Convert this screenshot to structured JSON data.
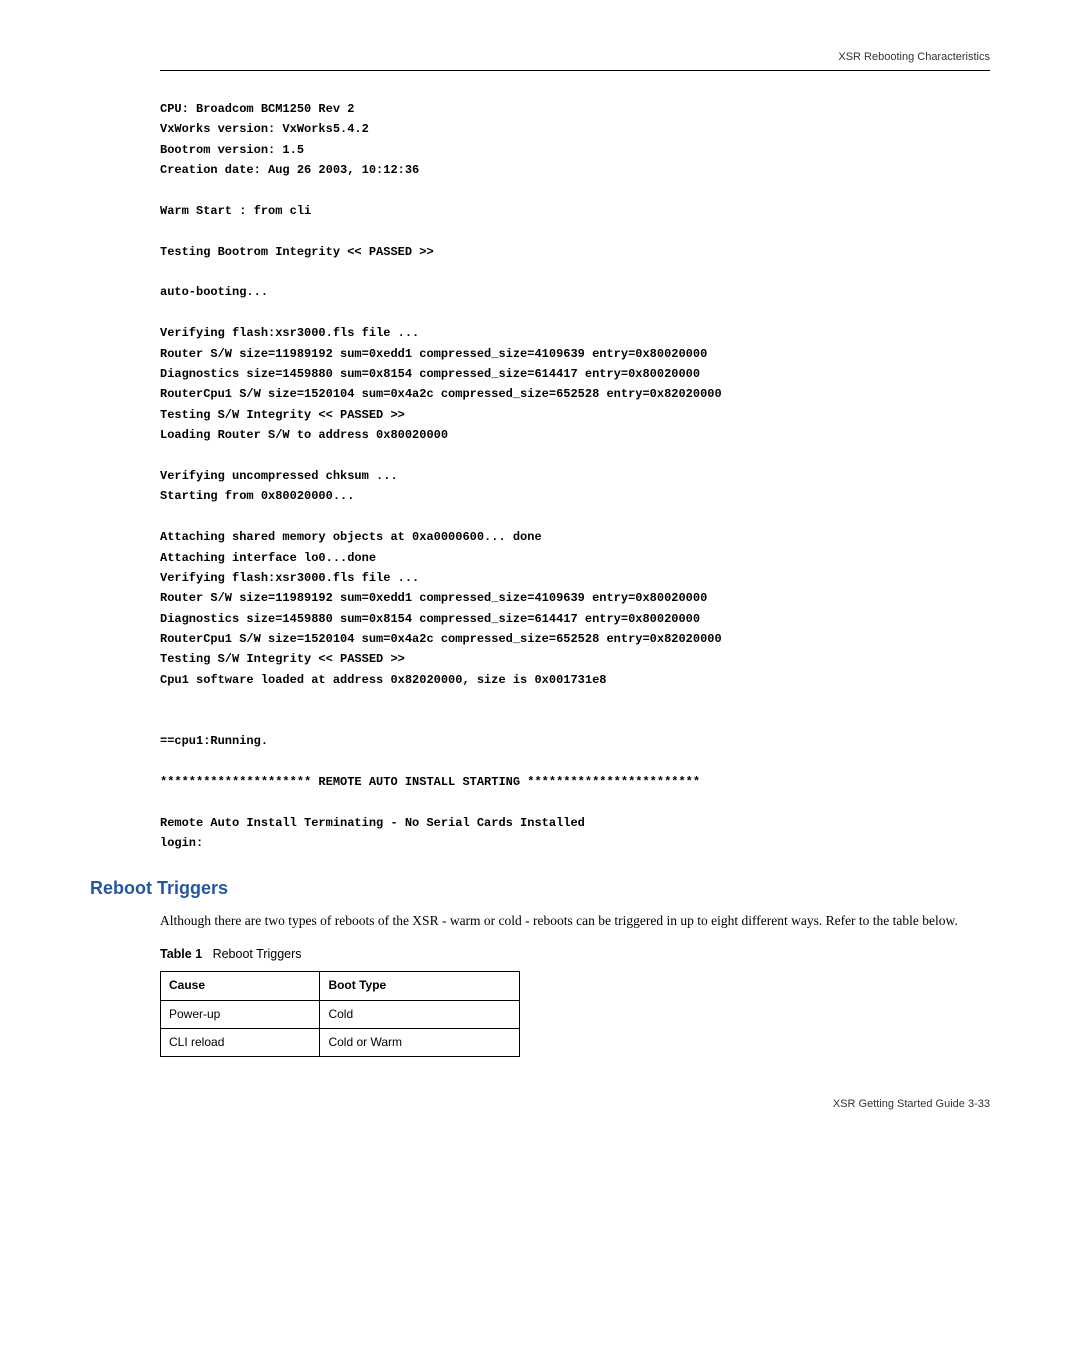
{
  "header": {
    "right": "XSR Rebooting Characteristics"
  },
  "code": "CPU: Broadcom BCM1250 Rev 2\nVxWorks version: VxWorks5.4.2\nBootrom version: 1.5\nCreation date: Aug 26 2003, 10:12:36\n\nWarm Start : from cli\n\nTesting Bootrom Integrity << PASSED >>\n\nauto-booting...\n\nVerifying flash:xsr3000.fls file ...\nRouter S/W size=11989192 sum=0xedd1 compressed_size=4109639 entry=0x80020000\nDiagnostics size=1459880 sum=0x8154 compressed_size=614417 entry=0x80020000\nRouterCpu1 S/W size=1520104 sum=0x4a2c compressed_size=652528 entry=0x82020000\nTesting S/W Integrity << PASSED >>\nLoading Router S/W to address 0x80020000\n\nVerifying uncompressed chksum ...\nStarting from 0x80020000...\n\nAttaching shared memory objects at 0xa0000600... done\nAttaching interface lo0...done\nVerifying flash:xsr3000.fls file ...\nRouter S/W size=11989192 sum=0xedd1 compressed_size=4109639 entry=0x80020000\nDiagnostics size=1459880 sum=0x8154 compressed_size=614417 entry=0x80020000\nRouterCpu1 S/W size=1520104 sum=0x4a2c compressed_size=652528 entry=0x82020000\nTesting S/W Integrity << PASSED >>\nCpu1 software loaded at address 0x82020000, size is 0x001731e8\n\n\n==cpu1:Running.\n\n********************* REMOTE AUTO INSTALL STARTING ************************\n\nRemote Auto Install Terminating - No Serial Cards Installed\nlogin:",
  "section": {
    "title": "Reboot Triggers"
  },
  "paragraph": "Although there are two types of reboots of the XSR - warm or cold - reboots can be triggered in up to eight different ways. Refer to the table below.",
  "table": {
    "caption_label": "Table 1",
    "caption_text": "Reboot Triggers",
    "head": {
      "c1": "Cause",
      "c2": "Boot Type"
    },
    "rows": [
      {
        "c1": "Power-up",
        "c2": "Cold"
      },
      {
        "c1": "CLI reload",
        "c2": "Cold or Warm"
      }
    ]
  },
  "footer": {
    "text": "XSR Getting Started Guide   3-33"
  }
}
